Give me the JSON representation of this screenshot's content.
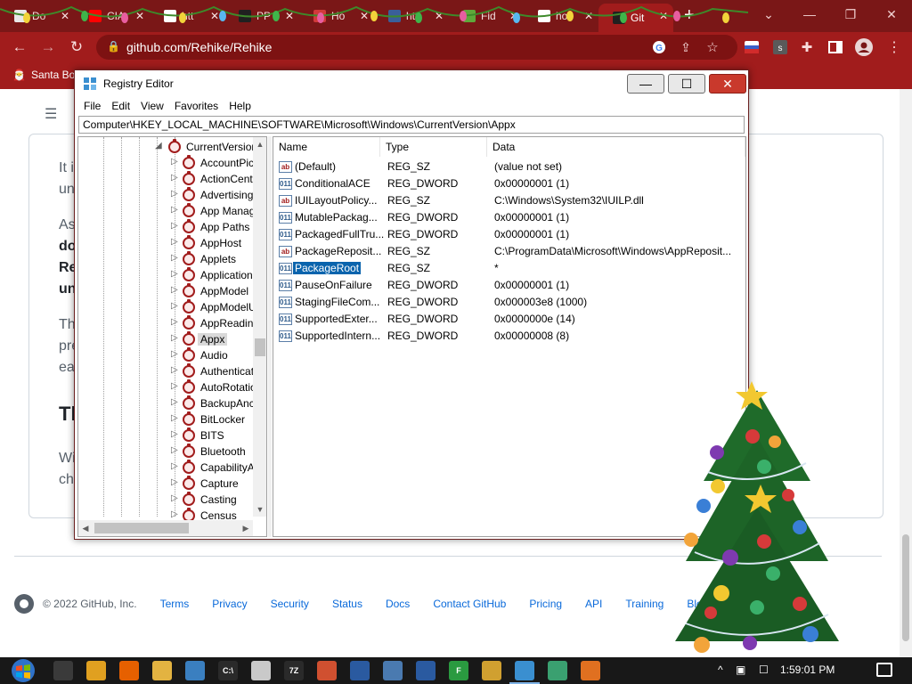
{
  "browser": {
    "tabs": [
      {
        "label": "Do",
        "favicon_color": "#e8e8e8"
      },
      {
        "label": "CIA",
        "favicon_color": "#ff0000"
      },
      {
        "label": "htt",
        "favicon_color": "#ffffff"
      },
      {
        "label": "PP",
        "favicon_color": "#202020"
      },
      {
        "label": "Ho",
        "favicon_color": "#d23a3a"
      },
      {
        "label": "htt",
        "favicon_color": "#3a5f9a"
      },
      {
        "label": "Fid",
        "favicon_color": "#5fa83a"
      },
      {
        "label": "hov",
        "favicon_color": "#ffffff"
      },
      {
        "label": "Git",
        "favicon_color": "#202020"
      }
    ],
    "active_tab_index": 8,
    "new_tab_label": "+",
    "url": "github.com/Rehike/Rehike",
    "bookmark": "Santa Bo"
  },
  "github": {
    "partial_lines": [
      {
        "text": "It i",
        "bold": false
      },
      {
        "text": "un",
        "bold": false
      },
      {
        "text": "As",
        "bold": false
      },
      {
        "text": "do",
        "bold": true
      },
      {
        "text": "Re",
        "bold": true
      },
      {
        "text": "un",
        "bold": true
      },
      {
        "text": "Th",
        "bold": false
      },
      {
        "text": "pre",
        "bold": false
      },
      {
        "text": "ea",
        "bold": false
      },
      {
        "text": "Wi",
        "bold": false
      },
      {
        "text": "ch",
        "bold": false
      }
    ],
    "heading": "Th",
    "footer": {
      "copyright": "© 2022 GitHub, Inc.",
      "links": [
        "Terms",
        "Privacy",
        "Security",
        "Status",
        "Docs",
        "Contact GitHub",
        "Pricing",
        "API",
        "Training",
        "Blog"
      ]
    }
  },
  "regedit": {
    "title": "Registry Editor",
    "window_buttons": {
      "minimize": "—",
      "maximize": "☐",
      "close": "✕"
    },
    "menu": [
      "File",
      "Edit",
      "View",
      "Favorites",
      "Help"
    ],
    "address": "Computer\\HKEY_LOCAL_MACHINE\\SOFTWARE\\Microsoft\\Windows\\CurrentVersion\\Appx",
    "tree": {
      "parent": "CurrentVersion",
      "children": [
        "AccountPic",
        "ActionCent",
        "Advertising",
        "App Manag",
        "App Paths",
        "AppHost",
        "Applets",
        "Application",
        "AppModel",
        "AppModelU",
        "AppReadin",
        "Appx",
        "Audio",
        "Authenticat",
        "AutoRotatio",
        "BackupAnc",
        "BitLocker",
        "BITS",
        "Bluetooth",
        "CapabilityA",
        "Capture",
        "Casting",
        "Census"
      ],
      "selected": "Appx"
    },
    "columns": [
      "Name",
      "Type",
      "Data"
    ],
    "values": [
      {
        "name": "(Default)",
        "type": "REG_SZ",
        "data": "(value not set)",
        "kind": "string"
      },
      {
        "name": "ConditionalACE",
        "type": "REG_DWORD",
        "data": "0x00000001 (1)",
        "kind": "binary"
      },
      {
        "name": "IUILayoutPolicy...",
        "type": "REG_SZ",
        "data": "C:\\Windows\\System32\\IUILP.dll",
        "kind": "string"
      },
      {
        "name": "MutablePackag...",
        "type": "REG_DWORD",
        "data": "0x00000001 (1)",
        "kind": "binary"
      },
      {
        "name": "PackagedFullTru...",
        "type": "REG_DWORD",
        "data": "0x00000001 (1)",
        "kind": "binary"
      },
      {
        "name": "PackageReposit...",
        "type": "REG_SZ",
        "data": "C:\\ProgramData\\Microsoft\\Windows\\AppReposit...",
        "kind": "string"
      },
      {
        "name": "PackageRoot",
        "type": "REG_SZ",
        "data": "*",
        "kind": "binary"
      },
      {
        "name": "PauseOnFailure",
        "type": "REG_DWORD",
        "data": "0x00000001 (1)",
        "kind": "binary"
      },
      {
        "name": "StagingFileCom...",
        "type": "REG_DWORD",
        "data": "0x000003e8 (1000)",
        "kind": "binary"
      },
      {
        "name": "SupportedExter...",
        "type": "REG_DWORD",
        "data": "0x0000000e (14)",
        "kind": "binary"
      },
      {
        "name": "SupportedIntern...",
        "type": "REG_DWORD",
        "data": "0x00000008 (8)",
        "kind": "binary"
      }
    ],
    "selected_value": "PackageRoot"
  },
  "taskbar": {
    "apps": [
      {
        "name": "task-view",
        "label": "",
        "color": "#3a3a3a"
      },
      {
        "name": "chrome",
        "label": "",
        "color": "#e0a020"
      },
      {
        "name": "firefox",
        "label": "",
        "color": "#e66000"
      },
      {
        "name": "file-explorer",
        "label": "",
        "color": "#e3b341"
      },
      {
        "name": "regedit",
        "label": "",
        "color": "#3a7fc0"
      },
      {
        "name": "command-prompt",
        "label": "C:\\",
        "color": "#2a2a2a"
      },
      {
        "name": "package",
        "label": "",
        "color": "#c9c9c9"
      },
      {
        "name": "7zip",
        "label": "7Z",
        "color": "#2a2a2a"
      },
      {
        "name": "git",
        "label": "",
        "color": "#d05030"
      },
      {
        "name": "powershell",
        "label": "",
        "color": "#2a5aa0"
      },
      {
        "name": "window-app",
        "label": "",
        "color": "#4a7ab0"
      },
      {
        "name": "powershell-2",
        "label": "",
        "color": "#2a5aa0"
      },
      {
        "name": "app-green",
        "label": "F",
        "color": "#2a9a40"
      },
      {
        "name": "app-grid",
        "label": "",
        "color": "#d0a030"
      },
      {
        "name": "regedit-active",
        "label": "",
        "color": "#3a8fd0"
      },
      {
        "name": "app-book",
        "label": "",
        "color": "#3aa070"
      },
      {
        "name": "xampp",
        "label": "",
        "color": "#e07020"
      }
    ],
    "tray": {
      "chevron": "^",
      "wifi": "☐",
      "volume": "🔈"
    },
    "clock": "1:59:01 PM"
  }
}
